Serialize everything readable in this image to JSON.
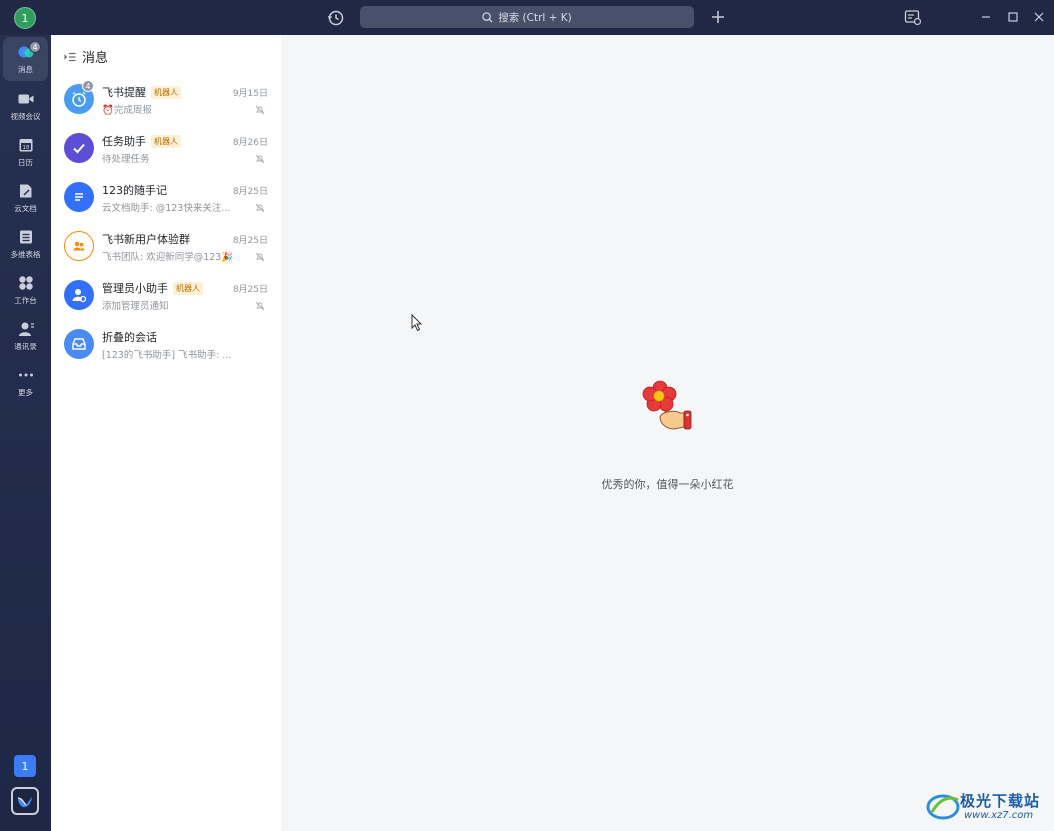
{
  "titlebar": {
    "avatar_text": "1",
    "search_placeholder": "搜索 (Ctrl + K)"
  },
  "rail": {
    "items": [
      {
        "label": "消息",
        "icon": "message-icon",
        "badge": "4"
      },
      {
        "label": "视频会议",
        "icon": "video-icon"
      },
      {
        "label": "日历",
        "icon": "calendar-icon"
      },
      {
        "label": "云文档",
        "icon": "cloud-doc-icon"
      },
      {
        "label": "多维表格",
        "icon": "base-table-icon"
      },
      {
        "label": "工作台",
        "icon": "workplace-icon"
      },
      {
        "label": "通讯录",
        "icon": "contacts-icon"
      },
      {
        "label": "更多",
        "icon": "more-icon"
      }
    ],
    "bottom_badge": "1"
  },
  "list": {
    "header": "消息",
    "conversations": [
      {
        "title": "飞书提醒",
        "tag": "机器人",
        "subtitle": "⏰完成周报",
        "date": "9月15日",
        "badge": "4",
        "color": "#4a9cf2"
      },
      {
        "title": "任务助手",
        "tag": "机器人",
        "subtitle": "待处理任务",
        "date": "8月26日",
        "color": "#5b4fd6"
      },
      {
        "title": "123的随手记",
        "subtitle": "云文档助手: @123快来关注...",
        "date": "8月25日",
        "color": "#3370ff"
      },
      {
        "title": "飞书新用户体验群",
        "subtitle": "飞书团队: 欢迎新同学@123🎉",
        "date": "8月25日",
        "color": "#ff8800"
      },
      {
        "title": "管理员小助手",
        "tag": "机器人",
        "subtitle": "添加管理员通知",
        "date": "8月25日",
        "color": "#3370ff"
      },
      {
        "title": "折叠的会话",
        "subtitle": "[123的飞书助手] 飞书助手: ...",
        "color": "#4a8af4"
      }
    ]
  },
  "main": {
    "empty_text": "优秀的你，值得一朵小红花"
  },
  "watermark": {
    "text": "极光下载站",
    "url": "www.xz7.com"
  }
}
